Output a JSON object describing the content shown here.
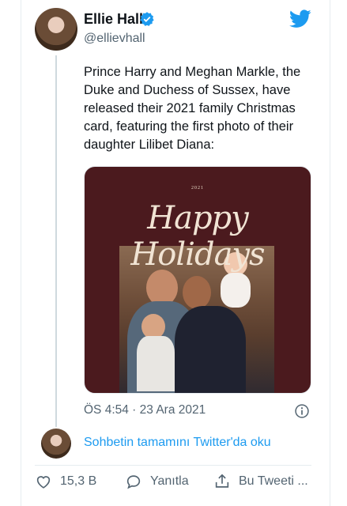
{
  "author": {
    "name": "Ellie Hall",
    "handle": "@ellievhall"
  },
  "tweet": {
    "text": "Prince Harry and Meghan Markle, the Duke and Duchess of Sussex, have released their 2021 family Christmas card, featuring the first photo of their daughter Lilibet Diana:",
    "media": {
      "year": "2021",
      "headline": "Happy Holidays"
    },
    "timestamp": "ÖS 4:54 · 23 Ara 2021"
  },
  "thread": {
    "continue_label": "Sohbetin tamamını Twitter'da oku"
  },
  "actions": {
    "like_count": "15,3 B",
    "reply_label": "Yanıtla",
    "share_label": "Bu Tweeti ..."
  },
  "colors": {
    "accent": "#1d9bf0",
    "card_background": "#4b1a1e"
  },
  "icons": [
    "verified-badge-icon",
    "twitter-logo-icon",
    "info-icon",
    "heart-icon",
    "reply-icon",
    "share-icon"
  ]
}
